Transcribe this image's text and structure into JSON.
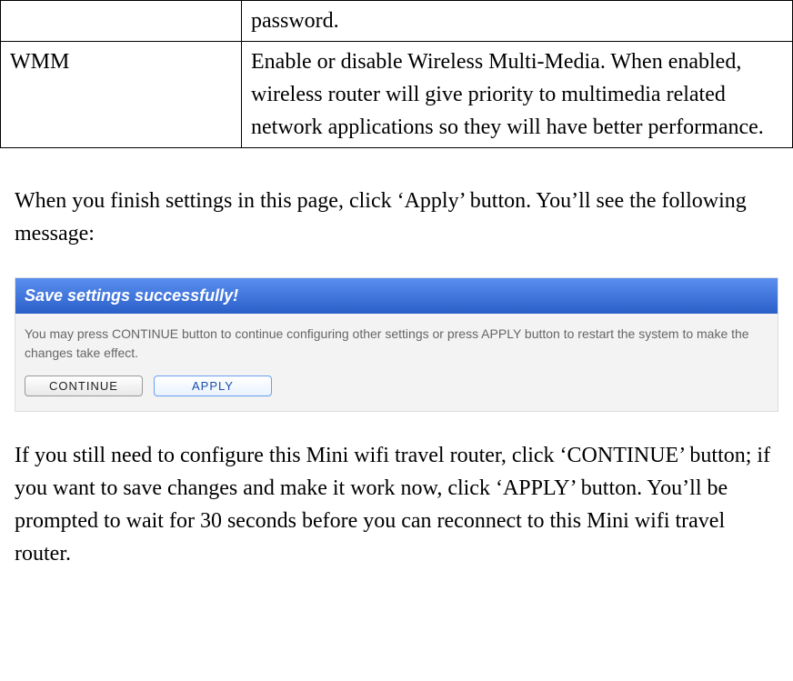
{
  "table": {
    "rows": [
      {
        "label": "",
        "desc": "password."
      },
      {
        "label": "WMM",
        "desc": "Enable or disable Wireless Multi-Media. When enabled, wireless router will give priority to multimedia related network applications so they will have better performance."
      }
    ]
  },
  "para1": "When you finish settings in this page, click ‘Apply’ button. You’ll see the following message:",
  "screenshot": {
    "header": "Save settings successfully!",
    "body": "You may press CONTINUE button to continue configuring other settings or press APPLY button to restart the system to make the changes take effect.",
    "continueLabel": "CONTINUE",
    "applyLabel": "APPLY"
  },
  "para2": "If you still need to configure this Mini wifi travel router, click ‘CONTINUE’ button; if you want to save changes and make it work now, click ‘APPLY’ button. You’ll be prompted to wait for 30 seconds before you can reconnect to this Mini wifi travel router."
}
